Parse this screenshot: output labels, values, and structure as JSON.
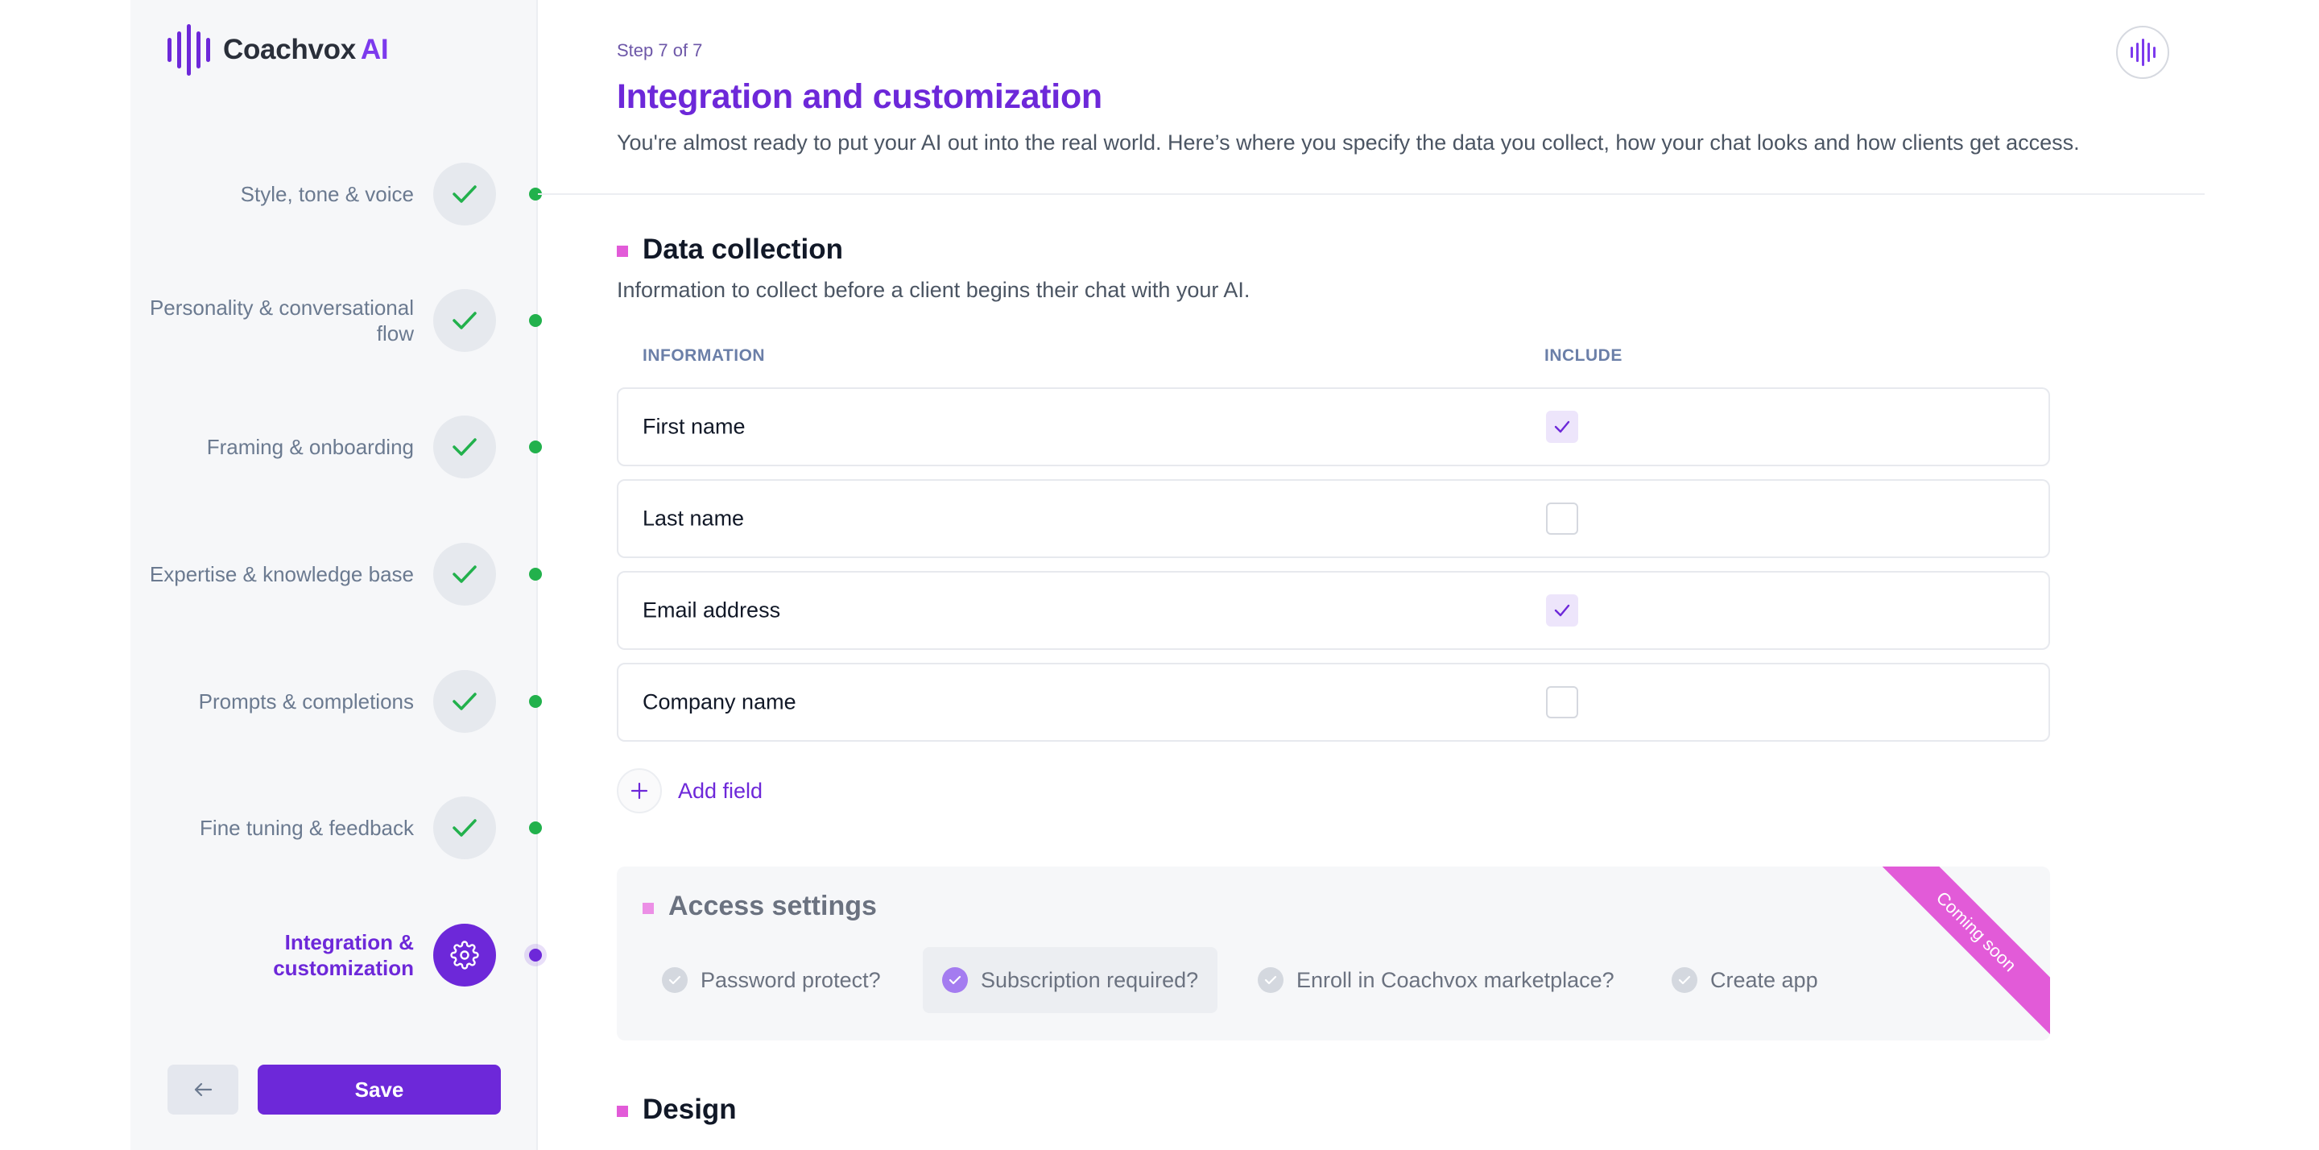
{
  "brand": {
    "name": "Coachvox",
    "suffix": "AI"
  },
  "sidebar": {
    "steps": [
      {
        "label": "Style, tone & voice",
        "status": "complete",
        "icon": "check-icon"
      },
      {
        "label": "Personality & conversational flow",
        "status": "complete",
        "icon": "check-icon"
      },
      {
        "label": "Framing & onboarding",
        "status": "complete",
        "icon": "check-icon"
      },
      {
        "label": "Expertise & knowledge base",
        "status": "complete",
        "icon": "check-icon"
      },
      {
        "label": "Prompts & completions",
        "status": "complete",
        "icon": "check-icon"
      },
      {
        "label": "Fine tuning & feedback",
        "status": "complete",
        "icon": "check-icon"
      },
      {
        "label": "Integration & customization",
        "status": "active",
        "icon": "gear-icon"
      }
    ],
    "back_icon": "arrow-left-icon",
    "save_label": "Save"
  },
  "header": {
    "step_indicator": "Step 7 of 7",
    "title": "Integration and customization",
    "subtitle": "You're almost ready to put your AI out into the real world. Here’s where you specify the data you collect, how your chat looks and how clients get access."
  },
  "data_collection": {
    "title": "Data collection",
    "description": "Information to collect before a client begins their chat with your AI.",
    "columns": {
      "information": "INFORMATION",
      "include": "INCLUDE"
    },
    "rows": [
      {
        "label": "First name",
        "included": true
      },
      {
        "label": "Last name",
        "included": false
      },
      {
        "label": "Email address",
        "included": true
      },
      {
        "label": "Company name",
        "included": false
      }
    ],
    "add_field_label": "Add field"
  },
  "access_settings": {
    "title": "Access settings",
    "badge": "Coming soon",
    "options": [
      {
        "label": "Password protect?",
        "selected": false
      },
      {
        "label": "Subscription required?",
        "selected": true
      },
      {
        "label": "Enroll in Coachvox marketplace?",
        "selected": false
      },
      {
        "label": "Create app",
        "selected": false
      }
    ]
  },
  "design": {
    "title": "Design"
  },
  "colors": {
    "accent": "#6d28d9",
    "complete": "#22b14c",
    "marker": "#e25bd8"
  }
}
